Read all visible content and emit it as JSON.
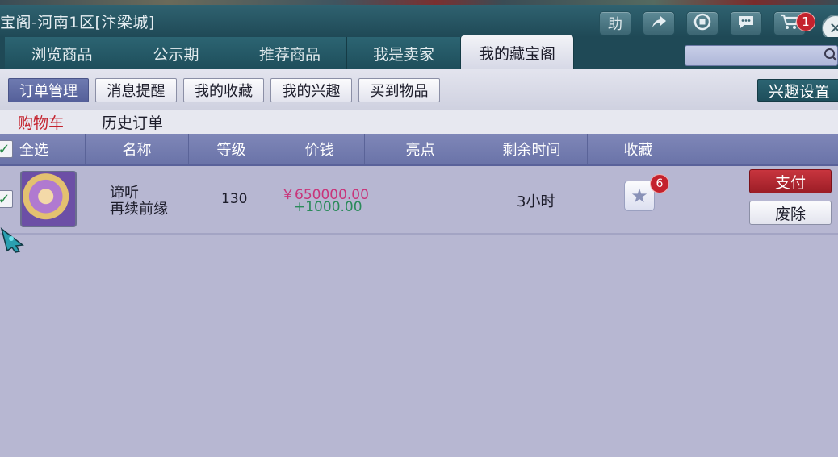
{
  "window": {
    "title": "宝阁-河南1区[汴梁城]"
  },
  "title_buttons": [
    {
      "name": "help",
      "label": "助"
    },
    {
      "name": "share",
      "icon": "share-arrow-icon"
    },
    {
      "name": "record",
      "icon": "record-icon"
    },
    {
      "name": "chat",
      "icon": "chat-bubble-icon"
    },
    {
      "name": "cart",
      "icon": "cart-icon",
      "badge": "1"
    }
  ],
  "tabs": [
    {
      "label": "浏览商品",
      "active": false
    },
    {
      "label": "公示期",
      "active": false
    },
    {
      "label": "推荐商品",
      "active": false
    },
    {
      "label": "我是卖家",
      "active": false
    },
    {
      "label": "我的藏宝阁",
      "active": true
    }
  ],
  "search": {
    "placeholder": "",
    "value": ""
  },
  "subtabs": [
    {
      "label": "订单管理",
      "active": true
    },
    {
      "label": "消息提醒",
      "active": false
    },
    {
      "label": "我的收藏",
      "active": false
    },
    {
      "label": "我的兴趣",
      "active": false
    },
    {
      "label": "买到物品",
      "active": false
    }
  ],
  "interest_settings_label": "兴趣设置",
  "cart_tabs": [
    {
      "label": "购物车",
      "active": true
    },
    {
      "label": "历史订单",
      "active": false
    }
  ],
  "table": {
    "headers": [
      "全选",
      "名称",
      "等级",
      "价钱",
      "亮点",
      "剩余时间",
      "收藏"
    ],
    "rows": [
      {
        "name_line1": "谛听",
        "name_line2": "再续前缘",
        "level": "130",
        "price": "￥650000.00",
        "price_extra": "+1000.00",
        "highlight": "",
        "remaining": "3小时",
        "favorites": "6",
        "pay_label": "支付",
        "delete_label": "废除"
      }
    ]
  },
  "colors": {
    "accent_teal": "#1f4956",
    "header_purple": "#6a73a8",
    "price_red": "#c8357a",
    "price_green": "#2a8a5a",
    "pay_red": "#9c1d26",
    "background": "#b7b7d2"
  }
}
